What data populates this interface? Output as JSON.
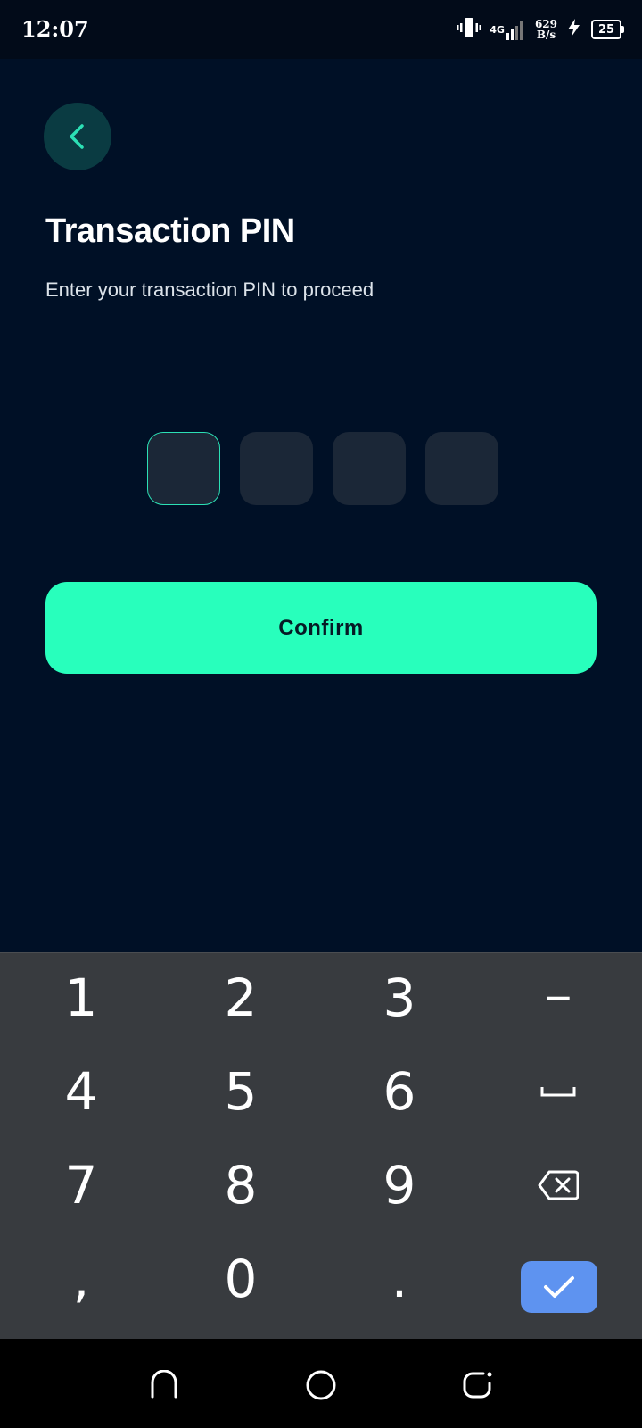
{
  "status_bar": {
    "time": "12:07",
    "network_type": "4G",
    "speed_value": "629",
    "speed_unit": "B/s",
    "battery_level": "25"
  },
  "header": {
    "title": "Transaction PIN",
    "subtitle": "Enter your transaction PIN to proceed"
  },
  "pin": {
    "length": 4,
    "active_index": 0,
    "accent_color": "#2ce0b5"
  },
  "confirm_button": {
    "label": "Confirm",
    "color": "#28ffbc"
  },
  "keyboard": {
    "rows": [
      [
        "1",
        "2",
        "3",
        "−"
      ],
      [
        "4",
        "5",
        "6",
        "space-icon"
      ],
      [
        "7",
        "8",
        "9",
        "backspace-icon"
      ],
      [
        ",",
        "0",
        ".",
        "check-icon"
      ]
    ],
    "k1": "1",
    "k2": "2",
    "k3": "3",
    "kminus": "−",
    "k4": "4",
    "k5": "5",
    "k6": "6",
    "k7": "7",
    "k8": "8",
    "k9": "9",
    "kcomma": ",",
    "k0": "0",
    "kdot": ".",
    "ok_color": "#5e93f0"
  },
  "nav_bar": {
    "buttons": [
      "recents-icon",
      "home-icon",
      "back-icon"
    ]
  }
}
